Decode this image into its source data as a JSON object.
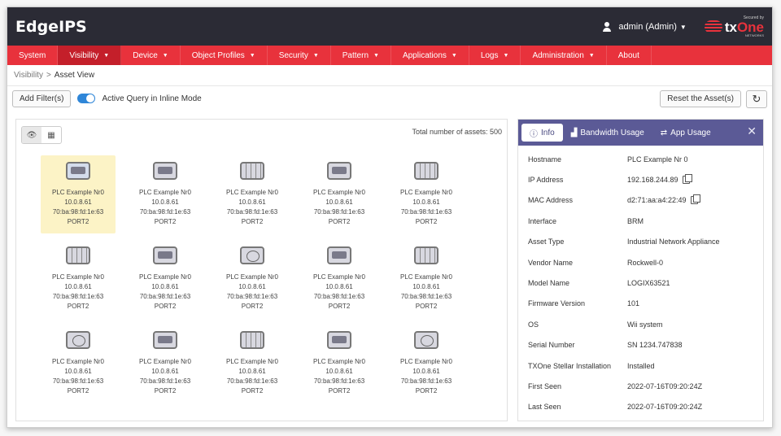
{
  "app": {
    "brand": "EdgeIPS"
  },
  "header": {
    "user": "admin (Admin)",
    "logo_top": "Secured by",
    "logo_main_a": "tx",
    "logo_main_b": "One",
    "logo_bottom": "NETWORKS"
  },
  "nav": [
    {
      "label": "System",
      "dropdown": false
    },
    {
      "label": "Visibility",
      "dropdown": true,
      "active": true
    },
    {
      "label": "Device",
      "dropdown": true
    },
    {
      "label": "Object Profiles",
      "dropdown": true
    },
    {
      "label": "Security",
      "dropdown": true
    },
    {
      "label": "Pattern",
      "dropdown": true
    },
    {
      "label": "Applications",
      "dropdown": true
    },
    {
      "label": "Logs",
      "dropdown": true
    },
    {
      "label": "Administration",
      "dropdown": true
    },
    {
      "label": "About",
      "dropdown": false
    }
  ],
  "breadcrumb": {
    "parent": "Visibility",
    "sep": ">",
    "current": "Asset View"
  },
  "toolbar": {
    "add_filter": "Add Filter(s)",
    "toggle_label": "Active Query in Inline Mode",
    "reset": "Reset the Asset(s)"
  },
  "assets": {
    "total_text": "Total number of assets: 500",
    "items": [
      {
        "name": "PLC Example Nr0",
        "ip": "10.0.8.61",
        "mac": "70:ba:98:fd:1e:63",
        "port": "PORT2",
        "icon": "plc-device-icon",
        "selected": true
      },
      {
        "name": "PLC Example Nr0",
        "ip": "10.0.8.61",
        "mac": "70:ba:98:fd:1e:63",
        "port": "PORT2",
        "icon": "hmi-device-icon"
      },
      {
        "name": "PLC Example Nr0",
        "ip": "10.0.8.61",
        "mac": "70:ba:98:fd:1e:63",
        "port": "PORT2",
        "icon": "server-device-icon"
      },
      {
        "name": "PLC Example Nr0",
        "ip": "10.0.8.61",
        "mac": "70:ba:98:fd:1e:63",
        "port": "PORT2",
        "icon": "controller-device-icon"
      },
      {
        "name": "PLC Example Nr0",
        "ip": "10.0.8.61",
        "mac": "70:ba:98:fd:1e:63",
        "port": "PORT2",
        "icon": "io-module-icon"
      },
      {
        "name": "PLC Example Nr0",
        "ip": "10.0.8.61",
        "mac": "70:ba:98:fd:1e:63",
        "port": "PORT2",
        "icon": "io-module-icon"
      },
      {
        "name": "PLC Example Nr0",
        "ip": "10.0.8.61",
        "mac": "70:ba:98:fd:1e:63",
        "port": "PORT2",
        "icon": "meter-device-icon"
      },
      {
        "name": "PLC Example Nr0",
        "ip": "10.0.8.61",
        "mac": "70:ba:98:fd:1e:63",
        "port": "PORT2",
        "icon": "cloud-device-icon"
      },
      {
        "name": "PLC Example Nr0",
        "ip": "10.0.8.61",
        "mac": "70:ba:98:fd:1e:63",
        "port": "PORT2",
        "icon": "controller-device-icon"
      },
      {
        "name": "PLC Example Nr0",
        "ip": "10.0.8.61",
        "mac": "70:ba:98:fd:1e:63",
        "port": "PORT2",
        "icon": "network-device-icon"
      },
      {
        "name": "PLC Example Nr0",
        "ip": "10.0.8.61",
        "mac": "70:ba:98:fd:1e:63",
        "port": "PORT2",
        "icon": "cloud-device-icon"
      },
      {
        "name": "PLC Example Nr0",
        "ip": "10.0.8.61",
        "mac": "70:ba:98:fd:1e:63",
        "port": "PORT2",
        "icon": "controller-device-icon"
      },
      {
        "name": "PLC Example Nr0",
        "ip": "10.0.8.61",
        "mac": "70:ba:98:fd:1e:63",
        "port": "PORT2",
        "icon": "io-module-icon"
      },
      {
        "name": "PLC Example Nr0",
        "ip": "10.0.8.61",
        "mac": "70:ba:98:fd:1e:63",
        "port": "PORT2",
        "icon": "meter-device-icon"
      },
      {
        "name": "PLC Example Nr0",
        "ip": "10.0.8.61",
        "mac": "70:ba:98:fd:1e:63",
        "port": "PORT2",
        "icon": "cloud-device-icon"
      }
    ]
  },
  "panel": {
    "tabs": [
      {
        "label": "Info",
        "icon": "info-icon"
      },
      {
        "label": "Bandwidth Usage",
        "icon": "chart-icon"
      },
      {
        "label": "App Usage",
        "icon": "swap-icon"
      }
    ],
    "fields": [
      {
        "k": "Hostname",
        "v": "PLC Example Nr 0"
      },
      {
        "k": "IP Address",
        "v": "192.168.244.89",
        "copy": true
      },
      {
        "k": "MAC Address",
        "v": "d2:71:aa:a4:22:49",
        "copy": true
      },
      {
        "k": "Interface",
        "v": "BRM"
      },
      {
        "k": "Asset Type",
        "v": "Industrial Network Appliance"
      },
      {
        "k": "Vendor Name",
        "v": "Rockwell-0"
      },
      {
        "k": "Model Name",
        "v": "LOGIX63521"
      },
      {
        "k": "Firmware Version",
        "v": "101"
      },
      {
        "k": "OS",
        "v": "Wii system"
      },
      {
        "k": "Serial Number",
        "v": "SN 1234.747838"
      },
      {
        "k": "TXOne Stellar Installation",
        "v": "Installed"
      },
      {
        "k": "First Seen",
        "v": "2022-07-16T09:20:24Z"
      },
      {
        "k": "Last Seen",
        "v": "2022-07-16T09:20:24Z"
      }
    ]
  }
}
